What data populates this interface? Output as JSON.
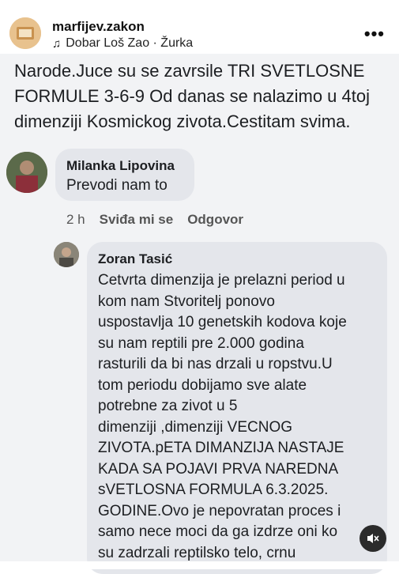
{
  "header": {
    "username": "marfijev.zakon",
    "audio": "Dobar Loš Zao · Žurka",
    "more_label": "•••"
  },
  "post": {
    "text": "Narode.Juce su se zavrsile TRI SVETLOSNE FORMULE 3-6-9 Od danas se nalazimo u 4toj dimenziji Kosmickog zivota.Cestitam svima."
  },
  "comments": [
    {
      "author": "Milanka Lipovina",
      "text": "Prevodi nam to",
      "time": "2 h",
      "like_label": "Sviđa mi se",
      "reply_label": "Odgovor"
    },
    {
      "author": "Zoran Tasić",
      "text": "Cetvrta dimenzija je prelazni period u\nkom nam Stvoritelj ponovo\nuspostavlja 10 genetskih kodova koje\nsu nam reptili pre 2.000 godina\nrasturili da bi nas drzali u ropstvu.U\ntom periodu dobijamo sve alate\npotrebne za zivot u 5\ndimenziji ,dimenziji VECNOG\nZIVOTA.pETA DIMANZIJA NASTAJE\nKADA SA POJAVI PRVA NAREDNA\nsVETLOSNA FORMULA 6.3.2025.\nGODINE.Ovo je nepovratan proces i\nsamo nece moci da ga izdrze oni ko\nsu zadrzali reptilsko telo, crnu"
    }
  ]
}
